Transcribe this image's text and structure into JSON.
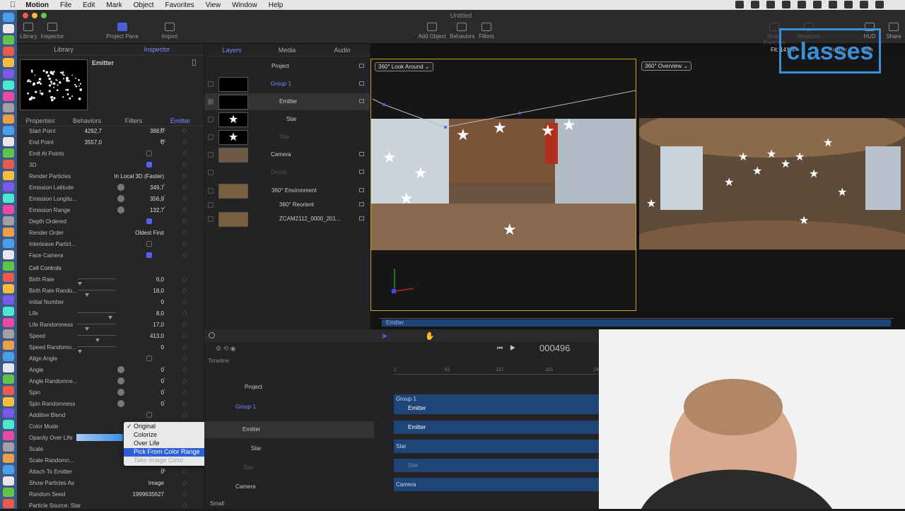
{
  "menubar": {
    "apple": "",
    "app": "Motion",
    "items": [
      "File",
      "Edit",
      "Mark",
      "Object",
      "Favorites",
      "View",
      "Window",
      "Help"
    ]
  },
  "window_title": "Untitled",
  "toolbar": {
    "library": "Library",
    "inspector": "Inspector",
    "project_pane": "Project Pane",
    "import": "Import",
    "add_object": "Add Object",
    "behaviors": "Behaviors",
    "filters": "Filters",
    "make_particles": "Make Particles",
    "replicate": "Replicate",
    "hud": "HUD",
    "share": "Share",
    "fit": "Fit: 141%",
    "render": "Render",
    "view": "View"
  },
  "left_panel": {
    "tabs": [
      "Library",
      "Inspector"
    ],
    "object_name": "Emitter",
    "subtabs": [
      "Properties",
      "Behaviors",
      "Filters",
      "Emitter"
    ],
    "rows": [
      {
        "label": "Start Point",
        "x": "4292,7",
        "y": "388,0",
        "unit": "px"
      },
      {
        "label": "End Point",
        "x": "3557,0",
        "y": "0",
        "unit": "px"
      },
      {
        "label": "Emit At Points",
        "type": "check",
        "on": false
      },
      {
        "label": "3D",
        "type": "check",
        "on": true
      },
      {
        "label": "Render Particles",
        "value": "In Local 3D (Faster)"
      },
      {
        "label": "Emission Latitude",
        "value": "349,7",
        "unit": "°",
        "dial": true
      },
      {
        "label": "Emission Longitu...",
        "value": "356,9",
        "unit": "°",
        "dial": true
      },
      {
        "label": "Emission Range",
        "value": "132,7",
        "unit": "°",
        "dial": true
      },
      {
        "label": "Depth Ordered",
        "type": "check",
        "on": true
      },
      {
        "label": "Render Order",
        "value": "Oldest First"
      },
      {
        "label": "Interleave Particl...",
        "type": "check",
        "on": false
      },
      {
        "label": "Face Camera",
        "type": "check",
        "on": true
      }
    ],
    "cell_controls_header": "Cell Controls",
    "cell_rows": [
      {
        "label": "Birth Rate",
        "value": "6,0",
        "level": 0.0
      },
      {
        "label": "Birth Rate Rando...",
        "value": "18,0",
        "level": 0.2
      },
      {
        "label": "Initial Number",
        "value": "0"
      },
      {
        "label": "Life",
        "value": "8,0",
        "level": 0.85
      },
      {
        "label": "Life Randomness",
        "value": "17,0",
        "level": 0.2
      },
      {
        "label": "Speed",
        "value": "413,0",
        "level": 0.5
      },
      {
        "label": "Speed Randomn...",
        "value": "0",
        "level": 0.0
      },
      {
        "label": "Align Angle",
        "type": "check",
        "on": false
      },
      {
        "label": "Angle",
        "value": "0",
        "unit": "°",
        "dial": true
      },
      {
        "label": "Angle Randomne...",
        "value": "0",
        "unit": "°",
        "dial": true
      },
      {
        "label": "Spin",
        "value": "0",
        "unit": "°",
        "dial": true
      },
      {
        "label": "Spin Randomness",
        "value": "0",
        "unit": "°",
        "dial": true
      },
      {
        "label": "Additive Blend",
        "type": "check",
        "on": false
      },
      {
        "label": "Color Mode",
        "value": ""
      },
      {
        "label": "Opacity Over Life",
        "value": ""
      },
      {
        "label": "Scale",
        "value": ""
      },
      {
        "label": "Scale Randomn...",
        "value": ""
      },
      {
        "label": "Attach To Emitter",
        "value": "0",
        "unit": "%"
      },
      {
        "label": "Show Particles As",
        "value": "Image"
      },
      {
        "label": "Random Seed",
        "value": "1999635627"
      },
      {
        "label": "Particle Source: Star",
        "value": ""
      }
    ]
  },
  "color_mode_menu": {
    "options": [
      "Original",
      "Colorize",
      "Over Life",
      "Pick From Color Range",
      "Take Image Color"
    ],
    "checked": "Original",
    "highlighted": "Pick From Color Range",
    "disabled": "Take Image Color"
  },
  "layers_panel": {
    "tabs": [
      "Layers",
      "Media",
      "Audio"
    ],
    "rows": [
      "Project",
      "Group 1",
      "Emitter",
      "Star",
      "Star",
      "Camera",
      "Group",
      "360° Environment",
      "360° Reorient",
      "ZCAM2112_0000_201..."
    ]
  },
  "canvas": {
    "left_view": "360° Look Around",
    "right_view": "360° Overview",
    "timing_bar_label": "Emitter"
  },
  "timeline": {
    "label": "Timeline",
    "timecode": "000496",
    "ruler": [
      "1",
      "61",
      "121",
      "181",
      "24"
    ],
    "rows": [
      "Project",
      "Group 1",
      "Emitter",
      "Star",
      "Star",
      "Camera"
    ],
    "bars": [
      "Group 1",
      "Emitter",
      "Emitter",
      "Star",
      "Star",
      "Camera"
    ],
    "zoom": "Small"
  },
  "logo": "classes",
  "colors": {
    "accent": "#7a8dff",
    "selection": "#2d60d8",
    "viewport_border": "#c9a32b",
    "track": "#1f4478"
  }
}
